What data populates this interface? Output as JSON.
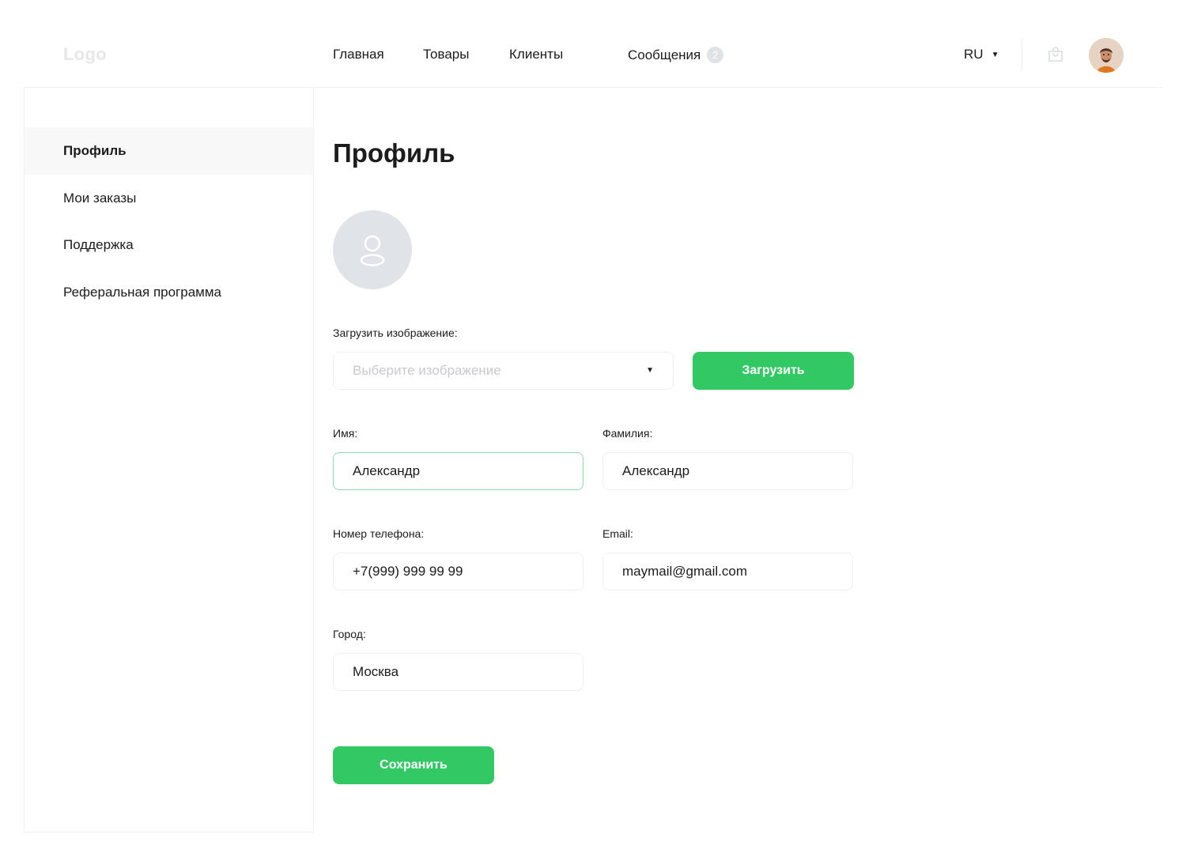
{
  "header": {
    "logo": "Logo",
    "nav": [
      {
        "label": "Главная"
      },
      {
        "label": "Товары"
      },
      {
        "label": "Клиенты"
      },
      {
        "label": "Сообщения",
        "badge": "2"
      }
    ],
    "language": "RU"
  },
  "sidebar": {
    "items": [
      {
        "label": "Профиль",
        "active": true
      },
      {
        "label": "Мои заказы"
      },
      {
        "label": "Поддержка"
      },
      {
        "label": "Реферальная программа"
      }
    ]
  },
  "profile": {
    "title": "Профиль",
    "upload": {
      "label": "Загрузить изображение:",
      "placeholder": "Выберите изображение",
      "button": "Загрузить"
    },
    "fields": {
      "first_name": {
        "label": "Имя:",
        "value": "Александр"
      },
      "last_name": {
        "label": "Фамилия:",
        "value": "Александр"
      },
      "phone": {
        "label": "Номер телефона:",
        "value": "+7(999) 999 99 99"
      },
      "email": {
        "label": "Email:",
        "value": "maymail@gmail.com"
      },
      "city": {
        "label": "Город:",
        "value": "Москва"
      }
    },
    "save_button": "Сохранить"
  },
  "colors": {
    "accent": "#32c964",
    "focus_border": "#8fd9a8",
    "avatar_placeholder": "#e0e3e8"
  }
}
